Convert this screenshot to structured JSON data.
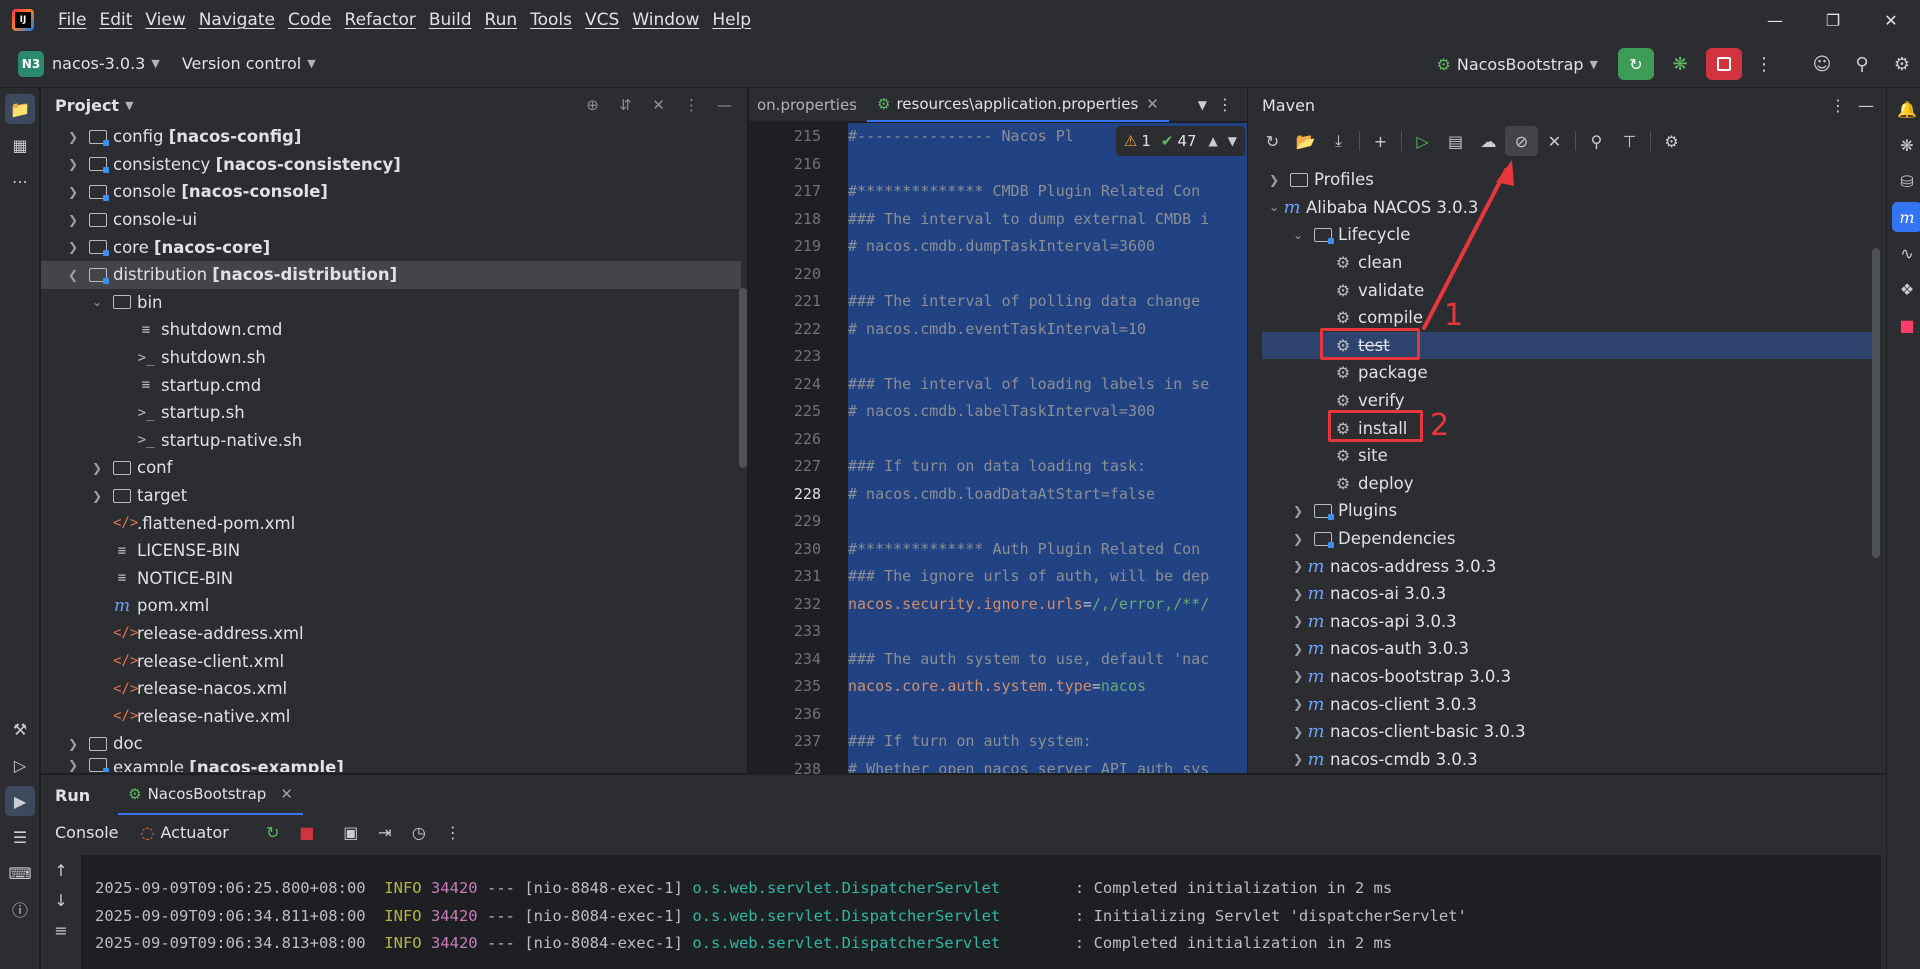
{
  "menu": [
    "File",
    "Edit",
    "View",
    "Navigate",
    "Code",
    "Refactor",
    "Build",
    "Run",
    "Tools",
    "VCS",
    "Window",
    "Help"
  ],
  "toolbar": {
    "project_badge": "N3",
    "project_name": "nacos-3.0.3",
    "vcs": "Version control",
    "run_config": "NacosBootstrap"
  },
  "project_panel": {
    "title": "Project",
    "rows": [
      {
        "name": "config",
        "module": "[nacos-config]"
      },
      {
        "name": "consistency",
        "module": "[nacos-consistency]"
      },
      {
        "name": "console",
        "module": "[nacos-console]"
      },
      {
        "name": "console-ui",
        "module": ""
      },
      {
        "name": "core",
        "module": "[nacos-core]"
      },
      {
        "name": "distribution",
        "module": "[nacos-distribution]"
      },
      {
        "name": "bin"
      },
      {
        "name": "shutdown.cmd"
      },
      {
        "name": "shutdown.sh"
      },
      {
        "name": "startup.cmd"
      },
      {
        "name": "startup.sh"
      },
      {
        "name": "startup-native.sh"
      },
      {
        "name": "conf"
      },
      {
        "name": "target"
      },
      {
        "name": ".flattened-pom.xml"
      },
      {
        "name": "LICENSE-BIN"
      },
      {
        "name": "NOTICE-BIN"
      },
      {
        "name": "pom.xml"
      },
      {
        "name": "release-address.xml"
      },
      {
        "name": "release-client.xml"
      },
      {
        "name": "release-nacos.xml"
      },
      {
        "name": "release-native.xml"
      },
      {
        "name": "doc"
      },
      {
        "name": "example",
        "module": "[nacos-example]"
      }
    ]
  },
  "editor": {
    "tabs": [
      "on.properties",
      "resources\\application.properties"
    ],
    "inspections": {
      "warnings": "1",
      "ok": "47"
    },
    "line_numbers": [
      "215",
      "216",
      "217",
      "218",
      "219",
      "220",
      "221",
      "222",
      "223",
      "224",
      "225",
      "226",
      "227",
      "228",
      "229",
      "230",
      "231",
      "232",
      "233",
      "234",
      "235",
      "236",
      "237",
      "238"
    ],
    "lines": [
      "#--------------- Nacos Pl",
      "",
      "#************** CMDB Plugin Related Con",
      "### The interval to dump external CMDB i",
      "# nacos.cmdb.dumpTaskInterval=3600",
      "",
      "### The interval of polling data change",
      "# nacos.cmdb.eventTaskInterval=10",
      "",
      "### The interval of loading labels in se",
      "# nacos.cmdb.labelTaskInterval=300",
      "",
      "### If turn on data loading task:",
      "# nacos.cmdb.loadDataAtStart=false",
      "",
      "#************** Auth Plugin Related Con",
      "### The ignore urls of auth, will be dep",
      "",
      "",
      "### The auth system to use, default 'nac",
      "",
      "",
      "### If turn on auth system:",
      "# Whether open nacos server API auth sys"
    ],
    "kv1": {
      "key": "nacos.security.ignore.urls",
      "eq": "=",
      "value": "/,/error,/**/"
    },
    "kv2": {
      "key": "nacos.core.auth.system.type",
      "eq": "=",
      "value": "nacos"
    }
  },
  "maven": {
    "title": "Maven",
    "profiles": "Profiles",
    "root": "Alibaba NACOS 3.0.3",
    "lifecycle": "Lifecycle",
    "phases": [
      "clean",
      "validate",
      "compile",
      "test",
      "package",
      "verify",
      "install",
      "site",
      "deploy"
    ],
    "plugins": "Plugins",
    "dependencies": "Dependencies",
    "modules": [
      "nacos-address 3.0.3",
      "nacos-ai 3.0.3",
      "nacos-api 3.0.3",
      "nacos-auth 3.0.3",
      "nacos-bootstrap 3.0.3",
      "nacos-client 3.0.3",
      "nacos-client-basic 3.0.3",
      "nacos-cmdb 3.0.3"
    ],
    "annotation_1": "1",
    "annotation_2": "2"
  },
  "run_panel": {
    "label": "Run",
    "tab": "NacosBootstrap",
    "console": "Console",
    "actuator": "Actuator",
    "logs": [
      {
        "ts": "2025-09-09T09:06:25.800+08:00",
        "level": "INFO",
        "pid": "34420",
        "sep": "---",
        "thread": "[nio-8848-exec-1]",
        "cls": "o.s.web.servlet.DispatcherServlet",
        "msg": ": Completed initialization in 2 ms"
      },
      {
        "ts": "2025-09-09T09:06:34.811+08:00",
        "level": "INFO",
        "pid": "34420",
        "sep": "---",
        "thread": "[nio-8084-exec-1]",
        "cls": "o.s.web.servlet.DispatcherServlet",
        "msg": ": Initializing Servlet 'dispatcherServlet'"
      },
      {
        "ts": "2025-09-09T09:06:34.813+08:00",
        "level": "INFO",
        "pid": "34420",
        "sep": "---",
        "thread": "[nio-8084-exec-1]",
        "cls": "o.s.web.servlet.DispatcherServlet",
        "msg": ": Completed initialization in 2 ms"
      }
    ]
  },
  "colors": {
    "accent": "#3574f0",
    "annotation": "#e8373c",
    "run_green": "#3e9b58",
    "stop_red": "#d1343e"
  }
}
